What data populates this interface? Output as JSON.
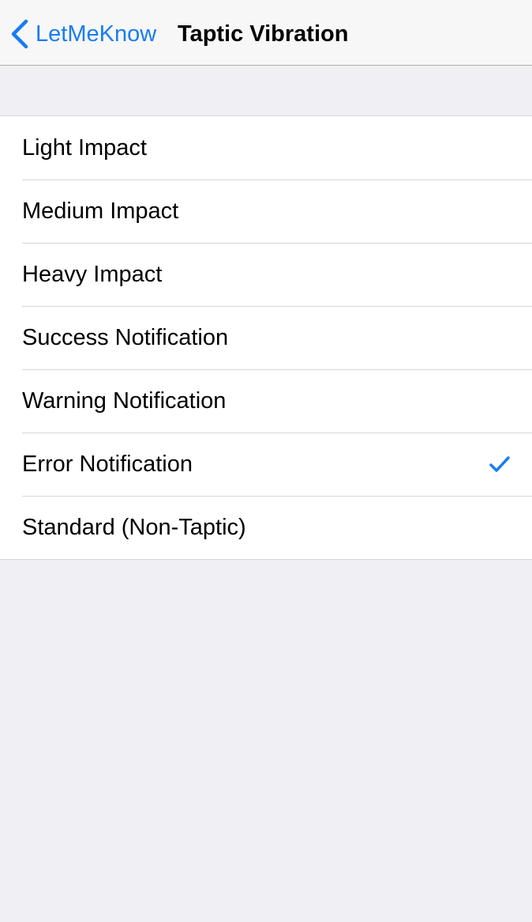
{
  "nav": {
    "back_label": "LetMeKnow",
    "back_icon": "chevron-left-icon",
    "title": "Taptic Vibration"
  },
  "options": [
    {
      "label": "Light Impact",
      "selected": false
    },
    {
      "label": "Medium Impact",
      "selected": false
    },
    {
      "label": "Heavy Impact",
      "selected": false
    },
    {
      "label": "Success Notification",
      "selected": false
    },
    {
      "label": "Warning Notification",
      "selected": false
    },
    {
      "label": "Error Notification",
      "selected": true
    },
    {
      "label": "Standard (Non-Taptic)",
      "selected": false
    }
  ],
  "colors": {
    "accent": "#1a7cf4",
    "background": "#efeff4",
    "navbar": "#f7f7f7",
    "separator": "#d6d6da"
  },
  "checkmark_icon": "checkmark-icon"
}
